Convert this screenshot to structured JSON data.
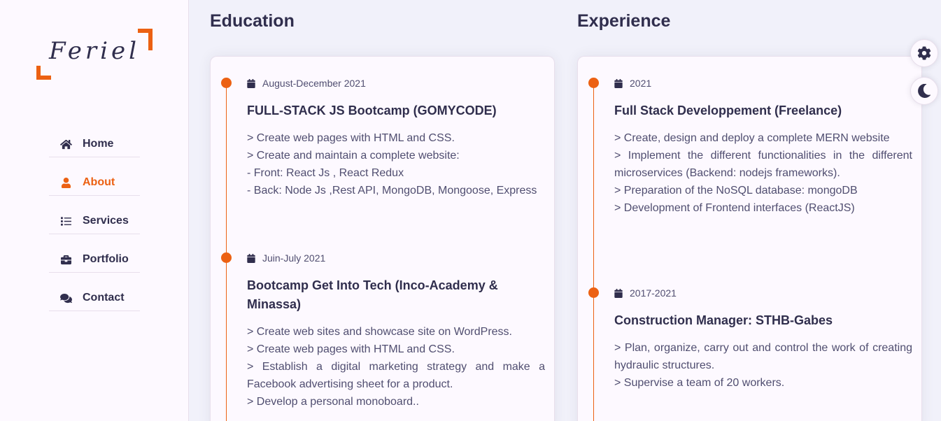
{
  "brand": {
    "logo_text": "Feriel",
    "accent_color": "#ec6113"
  },
  "nav": [
    {
      "label": "Home",
      "icon": "home-icon",
      "active": false
    },
    {
      "label": "About",
      "icon": "user-icon",
      "active": true
    },
    {
      "label": "Services",
      "icon": "list-icon",
      "active": false
    },
    {
      "label": "Portfolio",
      "icon": "briefcase-icon",
      "active": false
    },
    {
      "label": "Contact",
      "icon": "comments-icon",
      "active": false
    }
  ],
  "education": {
    "title": "Education",
    "items": [
      {
        "date": "August-December 2021",
        "title": "FULL-STACK JS Bootcamp (GOMYCODE)",
        "lines": [
          "> Create web pages with HTML and CSS.",
          "> Create and maintain a complete website:",
          "- Front: React Js , React Redux",
          "- Back: Node Js ,Rest API, MongoDB, Mongoose, Express"
        ]
      },
      {
        "date": "Juin-July 2021",
        "title": "Bootcamp Get Into Tech (Inco-Academy & Minassa)",
        "lines": [
          "> Create web sites and showcase site on WordPress.",
          "> Create web pages with HTML and CSS.",
          "> Establish a digital marketing strategy and make a Facebook advertising sheet for a product.",
          "> Develop a personal monoboard.."
        ]
      }
    ]
  },
  "experience": {
    "title": "Experience",
    "items": [
      {
        "date": "2021",
        "title": "Full Stack Developpement (Freelance)",
        "lines": [
          "> Create, design and deploy a complete MERN website",
          "> Implement the different functionalities in the different microservices (Backend: nodejs frameworks).",
          "> Preparation of the NoSQL database: mongoDB",
          "> Development of Frontend interfaces (ReactJS)"
        ]
      },
      {
        "date": "2017-2021",
        "title": "Construction Manager: STHB-Gabes",
        "lines": [
          "> Plan, organize, carry out and control the work of creating hydraulic structures.",
          "> Supervise a team of 20 workers."
        ]
      }
    ]
  },
  "style_switcher": {
    "settings_icon": "gear-icon",
    "theme_icon": "moon-icon"
  }
}
